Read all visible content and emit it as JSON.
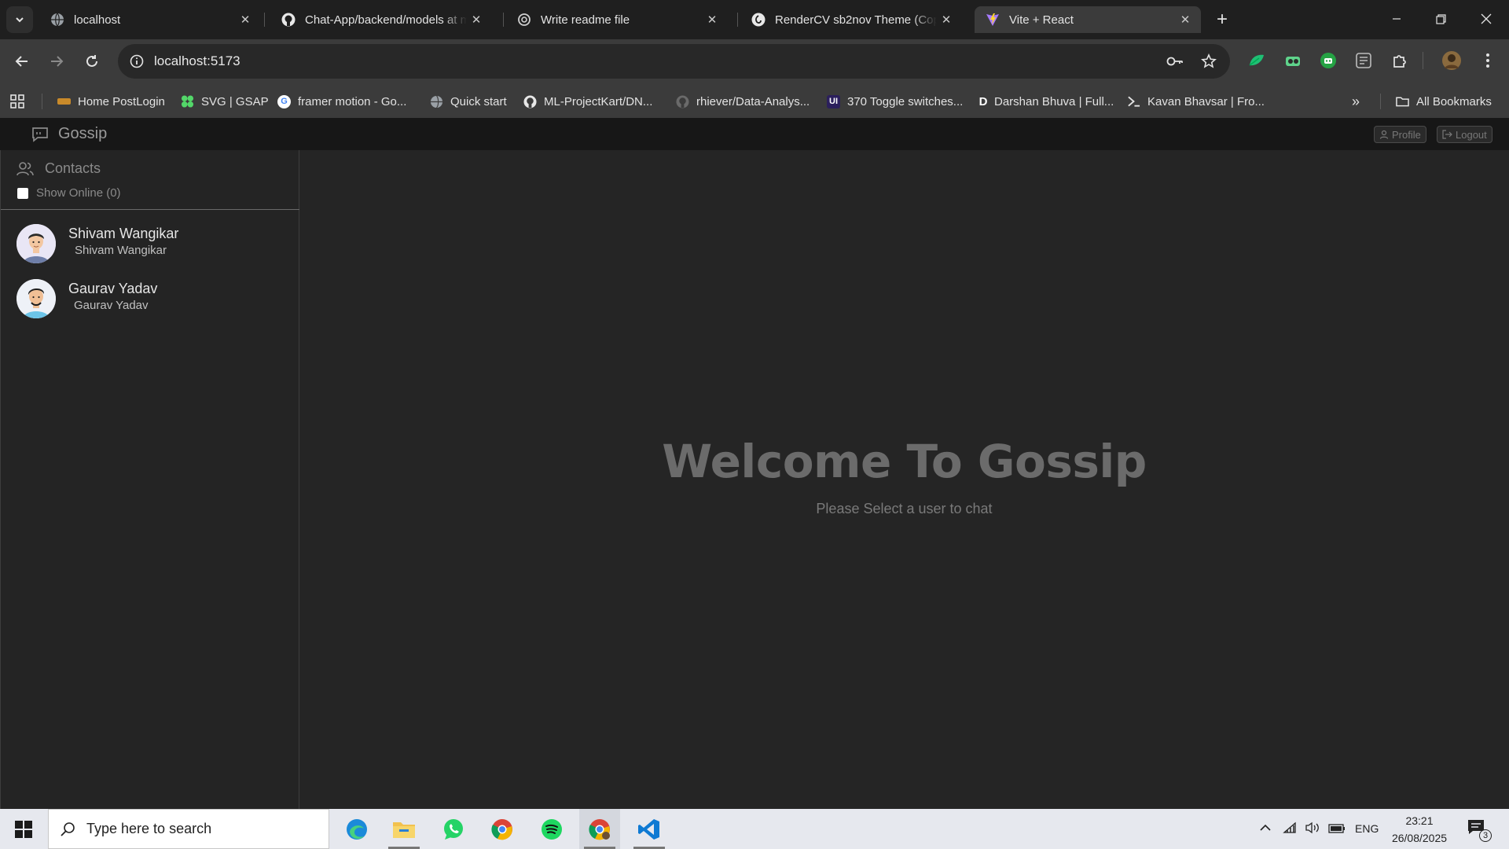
{
  "browser": {
    "tabs": [
      {
        "title": "localhost",
        "favicon": "globe-icon",
        "active": false
      },
      {
        "title": "Chat-App/backend/models at m",
        "favicon": "github-icon",
        "active": false
      },
      {
        "title": "Write readme file",
        "favicon": "openai-icon",
        "active": false
      },
      {
        "title": "RenderCV sb2nov Theme (Copy",
        "favicon": "overleaf-icon",
        "active": false
      },
      {
        "title": "Vite + React",
        "favicon": "vite-icon",
        "active": true
      }
    ],
    "url": "localhost:5173",
    "bookmarks": [
      {
        "label": "Home PostLogin",
        "icon": "site-icon"
      },
      {
        "label": "SVG | GSAP",
        "icon": "gsap-icon"
      },
      {
        "label": "framer motion - Go...",
        "icon": "google-icon"
      },
      {
        "label": "Quick start",
        "icon": "globe-icon"
      },
      {
        "label": "ML-ProjectKart/DN...",
        "icon": "github-icon"
      },
      {
        "label": "rhiever/Data-Analys...",
        "icon": "github-icon"
      },
      {
        "label": "370 Toggle switches...",
        "icon": "uiverse-icon"
      },
      {
        "label": "Darshan Bhuva | Full...",
        "icon": "d-icon"
      },
      {
        "label": "Kavan Bhavsar | Fro...",
        "icon": "terminal-icon"
      }
    ],
    "all_bookmarks": "All Bookmarks"
  },
  "app": {
    "brand": "Gossip",
    "profile_label": "Profile",
    "logout_label": "Logout",
    "sidebar": {
      "title": "Contacts",
      "show_online_label": "Show Online (0)",
      "contacts": [
        {
          "name": "Shivam Wangikar",
          "subtitle": "Shivam Wangikar"
        },
        {
          "name": "Gaurav Yadav",
          "subtitle": "Gaurav Yadav"
        }
      ]
    },
    "welcome": {
      "title": "Welcome To Gossip",
      "subtitle": "Please Select a user to chat"
    }
  },
  "taskbar": {
    "search_placeholder": "Type here to search",
    "language": "ENG",
    "time": "23:21",
    "date": "26/08/2025",
    "notification_count": "3"
  }
}
